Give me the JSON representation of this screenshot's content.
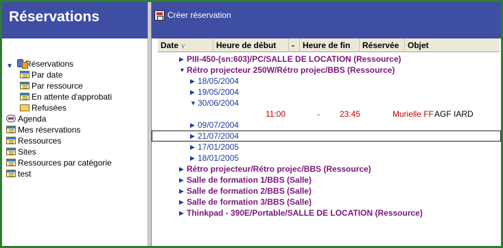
{
  "app_title": "Réservations",
  "toolbar": {
    "create_label": "Créer réservation"
  },
  "nav": {
    "items": [
      {
        "label": "Réservations",
        "icon": "database-icon",
        "expanded": true,
        "depth": 0
      },
      {
        "label": "Par date",
        "icon": "view-icon",
        "depth": 1
      },
      {
        "label": "Par ressource",
        "icon": "view-icon",
        "depth": 1
      },
      {
        "label": "En attente d'approbati",
        "icon": "view-icon",
        "depth": 1
      },
      {
        "label": "Refusées",
        "icon": "folder-icon",
        "depth": 1
      },
      {
        "label": "Agenda",
        "icon": "agenda-icon",
        "depth": 0
      },
      {
        "label": "Mes réservations",
        "icon": "view-icon",
        "depth": 0
      },
      {
        "label": "Ressources",
        "icon": "view-icon",
        "depth": 0
      },
      {
        "label": "Sites",
        "icon": "view-icon",
        "depth": 0
      },
      {
        "label": "Ressources par catégorie",
        "icon": "view-icon",
        "depth": 0
      },
      {
        "label": "test",
        "icon": "view-icon",
        "depth": 0
      }
    ]
  },
  "columns": {
    "date": "Date",
    "start": "Heure de début",
    "dash": "-",
    "end": "Heure de fin",
    "reserved": "Réservée",
    "object": "Objet"
  },
  "rows": [
    {
      "type": "category",
      "text": "PIII-450-(sn:603)/PC/SALLE DE LOCATION (Ressource)",
      "expanded": false
    },
    {
      "type": "category",
      "text": "Rétro projecteur 250W/Rétro projec/BBS (Ressource)",
      "expanded": true
    },
    {
      "type": "date",
      "text": "18/05/2004",
      "expanded": false
    },
    {
      "type": "date",
      "text": "19/05/2004",
      "expanded": false
    },
    {
      "type": "date",
      "text": "30/06/2004",
      "expanded": true
    },
    {
      "type": "entry",
      "start": "11:00",
      "dash": "-",
      "end": "23:45",
      "reserved": "Murielle FF",
      "object": "AGF IARD"
    },
    {
      "type": "date",
      "text": "09/07/2004",
      "expanded": false
    },
    {
      "type": "date",
      "text": "21/07/2004",
      "expanded": false,
      "focused": true
    },
    {
      "type": "date",
      "text": "17/01/2005",
      "expanded": false
    },
    {
      "type": "date",
      "text": "18/01/2005",
      "expanded": false
    },
    {
      "type": "category",
      "text": "Rétro projecteur/Rétro projec/BBS (Ressource)",
      "expanded": false
    },
    {
      "type": "category",
      "text": "Salle de formation 1/BBS (Salle)",
      "expanded": false
    },
    {
      "type": "category",
      "text": "Salle de formation 2/BBS (Salle)",
      "expanded": false
    },
    {
      "type": "category",
      "text": "Salle de formation 3/BBS (Salle)",
      "expanded": false
    },
    {
      "type": "category",
      "text": "Thinkpad - 390E/Portable/SALLE DE LOCATION (Ressource)",
      "expanded": false
    }
  ],
  "colors": {
    "header_bg": "#3e4ea3",
    "category_text": "#7a1678",
    "date_text": "#1a3d9c",
    "time_text": "#c00000",
    "frame": "#2f7d2f"
  }
}
